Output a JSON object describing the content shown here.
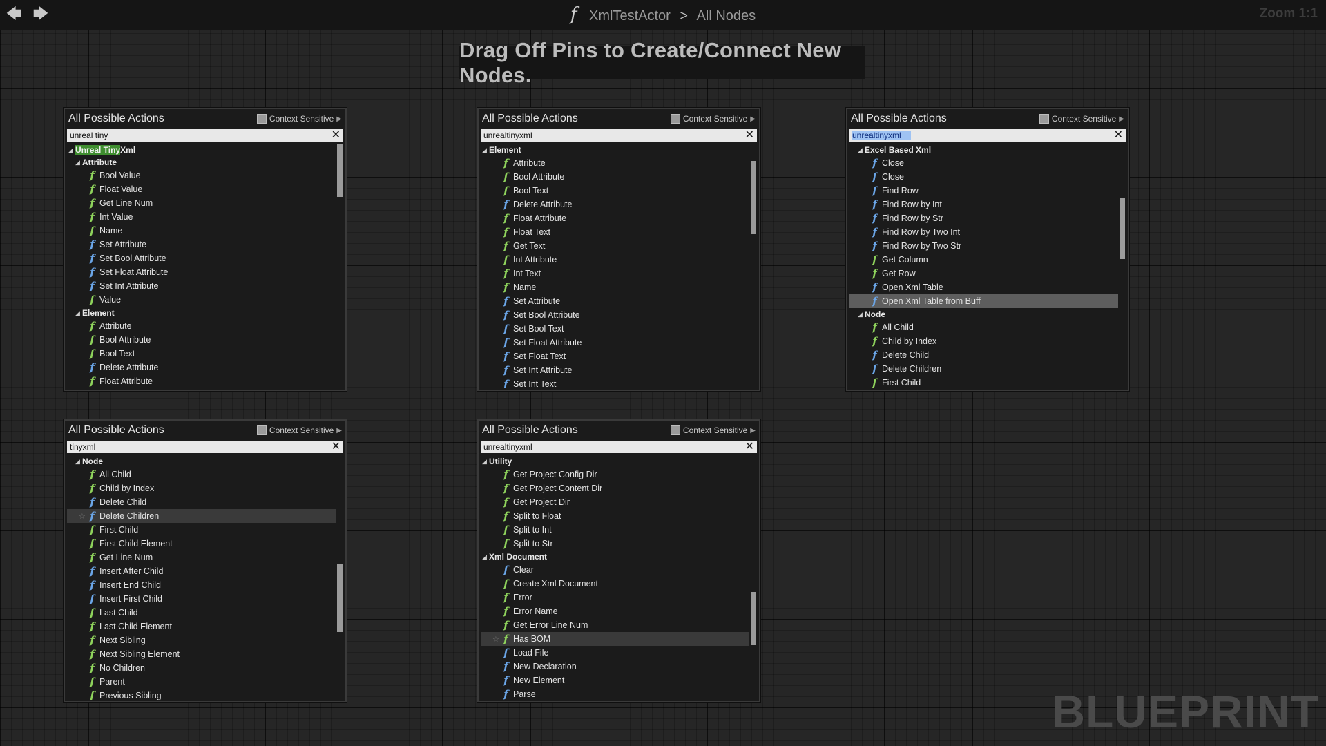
{
  "toolbar": {
    "back_icon": "back-arrow-icon",
    "forward_icon": "forward-arrow-icon",
    "function_glyph": "f",
    "breadcrumb_asset": "XmlTestActor",
    "breadcrumb_sep": ">",
    "breadcrumb_graph": "All Nodes",
    "zoom": "Zoom 1:1"
  },
  "hint": "Drag Off Pins to Create/Connect New Nodes.",
  "watermark": "BLUEPRINT",
  "menus": [
    {
      "title": "All Possible Actions",
      "context_label": "Context Sensitive",
      "search_value": "unreal tiny",
      "scroll_position": 0.0,
      "scroll_visible_fraction": 0.22,
      "rows": [
        {
          "type": "cat",
          "depth": 0,
          "text": "Unreal Tiny Xml",
          "match": "Unreal Tiny"
        },
        {
          "type": "cat",
          "depth": 1,
          "text": "Attribute"
        },
        {
          "type": "item",
          "text": "Bool Value"
        },
        {
          "type": "item",
          "text": "Float Value"
        },
        {
          "type": "item",
          "text": "Get Line Num"
        },
        {
          "type": "item",
          "text": "Int Value"
        },
        {
          "type": "item",
          "text": "Name"
        },
        {
          "type": "item",
          "text": "Set Attribute",
          "icon": "blue"
        },
        {
          "type": "item",
          "text": "Set Bool Attribute",
          "icon": "blue"
        },
        {
          "type": "item",
          "text": "Set Float Attribute",
          "icon": "blue"
        },
        {
          "type": "item",
          "text": "Set Int Attribute",
          "icon": "blue"
        },
        {
          "type": "item",
          "text": "Value"
        },
        {
          "type": "cat",
          "depth": 1,
          "text": "Element"
        },
        {
          "type": "item",
          "text": "Attribute"
        },
        {
          "type": "item",
          "text": "Bool Attribute"
        },
        {
          "type": "item",
          "text": "Bool Text"
        },
        {
          "type": "item",
          "text": "Delete Attribute",
          "icon": "blue"
        },
        {
          "type": "item",
          "text": "Float Attribute"
        }
      ]
    },
    {
      "title": "All Possible Actions",
      "context_label": "Context Sensitive",
      "search_value": "unrealtinyxml",
      "scroll_position": 0.1,
      "scroll_visible_fraction": 0.3,
      "rows": [
        {
          "type": "cat",
          "depth": 0,
          "text": "Element"
        },
        {
          "type": "item",
          "text": "Attribute"
        },
        {
          "type": "item",
          "text": "Bool Attribute"
        },
        {
          "type": "item",
          "text": "Bool Text"
        },
        {
          "type": "item",
          "text": "Delete Attribute",
          "icon": "blue"
        },
        {
          "type": "item",
          "text": "Float Attribute"
        },
        {
          "type": "item",
          "text": "Float Text"
        },
        {
          "type": "item",
          "text": "Get Text"
        },
        {
          "type": "item",
          "text": "Int Attribute"
        },
        {
          "type": "item",
          "text": "Int Text"
        },
        {
          "type": "item",
          "text": "Name"
        },
        {
          "type": "item",
          "text": "Set Attribute",
          "icon": "blue"
        },
        {
          "type": "item",
          "text": "Set Bool Attribute",
          "icon": "blue"
        },
        {
          "type": "item",
          "text": "Set Bool Text",
          "icon": "blue"
        },
        {
          "type": "item",
          "text": "Set Float Attribute",
          "icon": "blue"
        },
        {
          "type": "item",
          "text": "Set Float Text",
          "icon": "blue"
        },
        {
          "type": "item",
          "text": "Set Int Attribute",
          "icon": "blue"
        },
        {
          "type": "item",
          "text": "Set Int Text",
          "icon": "blue"
        }
      ]
    },
    {
      "title": "All Possible Actions",
      "context_label": "Context Sensitive",
      "search_value": "unrealtinyxml",
      "search_selected": true,
      "scroll_position": 0.3,
      "scroll_visible_fraction": 0.25,
      "rows": [
        {
          "type": "cat",
          "depth": 1,
          "text": "Excel Based Xml"
        },
        {
          "type": "item",
          "text": "Close",
          "icon": "blue"
        },
        {
          "type": "item",
          "text": "Close",
          "icon": "blue"
        },
        {
          "type": "item",
          "text": "Find Row",
          "icon": "blue"
        },
        {
          "type": "item",
          "text": "Find Row by Int",
          "icon": "blue"
        },
        {
          "type": "item",
          "text": "Find Row by Str",
          "icon": "blue"
        },
        {
          "type": "item",
          "text": "Find Row by Two Int",
          "icon": "blue"
        },
        {
          "type": "item",
          "text": "Find Row by Two Str",
          "icon": "blue"
        },
        {
          "type": "item",
          "text": "Get Column"
        },
        {
          "type": "item",
          "text": "Get Row"
        },
        {
          "type": "item",
          "text": "Open Xml Table",
          "icon": "blue"
        },
        {
          "type": "item",
          "text": "Open Xml Table from Buff",
          "icon": "blue",
          "state": "sel"
        },
        {
          "type": "cat",
          "depth": 1,
          "text": "Node"
        },
        {
          "type": "item",
          "text": "All Child"
        },
        {
          "type": "item",
          "text": "Child by Index"
        },
        {
          "type": "item",
          "text": "Delete Child",
          "icon": "blue"
        },
        {
          "type": "item",
          "text": "Delete Children",
          "icon": "blue"
        },
        {
          "type": "item",
          "text": "First Child"
        }
      ]
    },
    {
      "title": "All Possible Actions",
      "context_label": "Context Sensitive",
      "search_value": "tinyxml",
      "scroll_position": 0.62,
      "scroll_visible_fraction": 0.28,
      "rows": [
        {
          "type": "cat",
          "depth": 1,
          "text": "Node"
        },
        {
          "type": "item",
          "text": "All Child"
        },
        {
          "type": "item",
          "text": "Child by Index"
        },
        {
          "type": "item",
          "text": "Delete Child",
          "icon": "blue"
        },
        {
          "type": "item",
          "text": "Delete Children",
          "icon": "blue",
          "state": "hl",
          "star": true
        },
        {
          "type": "item",
          "text": "First Child"
        },
        {
          "type": "item",
          "text": "First Child Element"
        },
        {
          "type": "item",
          "text": "Get Line Num"
        },
        {
          "type": "item",
          "text": "Insert After Child",
          "icon": "blue"
        },
        {
          "type": "item",
          "text": "Insert End Child",
          "icon": "blue"
        },
        {
          "type": "item",
          "text": "Insert First Child",
          "icon": "blue"
        },
        {
          "type": "item",
          "text": "Last Child"
        },
        {
          "type": "item",
          "text": "Last Child Element"
        },
        {
          "type": "item",
          "text": "Next Sibling"
        },
        {
          "type": "item",
          "text": "Next Sibling Element"
        },
        {
          "type": "item",
          "text": "No Children"
        },
        {
          "type": "item",
          "text": "Parent"
        },
        {
          "type": "item",
          "text": "Previous Sibling"
        }
      ]
    },
    {
      "title": "All Possible Actions",
      "context_label": "Context Sensitive",
      "search_value": "unrealtinyxml",
      "scroll_position": 0.72,
      "scroll_visible_fraction": 0.22,
      "rows": [
        {
          "type": "cat",
          "depth": 0,
          "text": "Utility"
        },
        {
          "type": "item",
          "text": "Get Project Config Dir"
        },
        {
          "type": "item",
          "text": "Get Project Content Dir"
        },
        {
          "type": "item",
          "text": "Get Project Dir"
        },
        {
          "type": "item",
          "text": "Split to Float"
        },
        {
          "type": "item",
          "text": "Split to Int"
        },
        {
          "type": "item",
          "text": "Split to Str"
        },
        {
          "type": "cat",
          "depth": 0,
          "text": "Xml Document"
        },
        {
          "type": "item",
          "text": "Clear",
          "icon": "blue"
        },
        {
          "type": "item",
          "text": "Create Xml Document"
        },
        {
          "type": "item",
          "text": "Error"
        },
        {
          "type": "item",
          "text": "Error Name"
        },
        {
          "type": "item",
          "text": "Get Error Line Num"
        },
        {
          "type": "item",
          "text": "Has BOM",
          "state": "hl",
          "star": true
        },
        {
          "type": "item",
          "text": "Load File",
          "icon": "blue"
        },
        {
          "type": "item",
          "text": "New Declaration",
          "icon": "blue"
        },
        {
          "type": "item",
          "text": "New Element",
          "icon": "blue"
        },
        {
          "type": "item",
          "text": "Parse",
          "icon": "blue"
        }
      ]
    }
  ],
  "colors": {
    "pure_function_icon": "#8fd35c",
    "impure_function_icon": "#6ba6e8",
    "search_match_highlight": "#3f8e2f",
    "graph_background": "#262626"
  }
}
